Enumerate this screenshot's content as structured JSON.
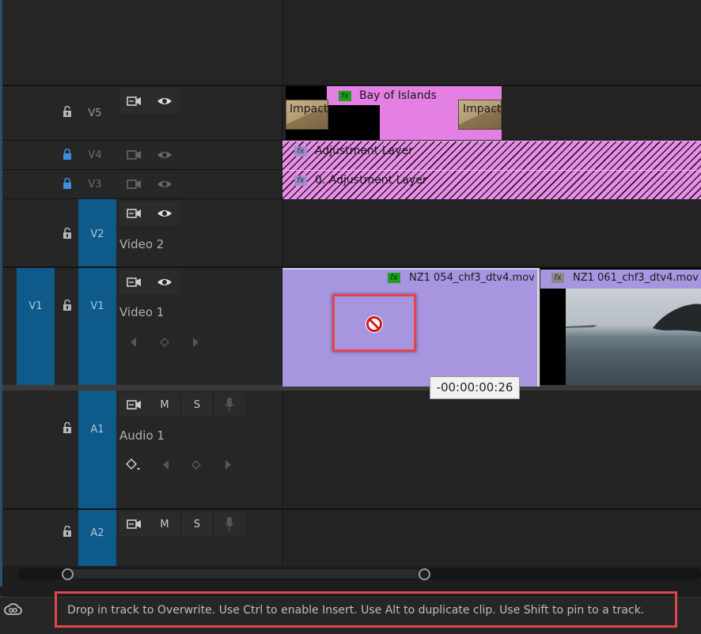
{
  "tracks": {
    "v5": {
      "label": "V5"
    },
    "v4": {
      "label": "V4"
    },
    "v3": {
      "label": "V3"
    },
    "v2": {
      "label": "V2",
      "name": "Video 2"
    },
    "v1": {
      "label": "V1",
      "name": "Video 1",
      "source_label": "V1"
    },
    "a1": {
      "label": "A1",
      "name": "Audio 1",
      "mute": "M",
      "solo": "S"
    },
    "a2": {
      "label": "A2",
      "mute": "M",
      "solo": "S"
    }
  },
  "clips": {
    "bay_of_islands": "Bay of Islands",
    "impact_left": "Impact",
    "impact_right": "Impact I",
    "adjustment_layer": "Adjustment Layer",
    "adjustment_layer_0": "0. Adjustment Layer",
    "nz1_054": "NZ1 054_chf3_dtv4.mov",
    "nz1_061": "NZ1 061_chf3_dtv4.mov",
    "fx": "fx"
  },
  "drag_timecode": "-00:00:00:26",
  "status_message": "Drop in track to Overwrite. Use Ctrl to enable Insert. Use Alt to duplicate clip. Use Shift to pin to a track.",
  "colors": {
    "track_target_blue": "#0e5a8a",
    "adjustment_pink": "#e88ee8",
    "nz1_054_purple": "#a895e0",
    "highlight_red": "#e0474c"
  }
}
